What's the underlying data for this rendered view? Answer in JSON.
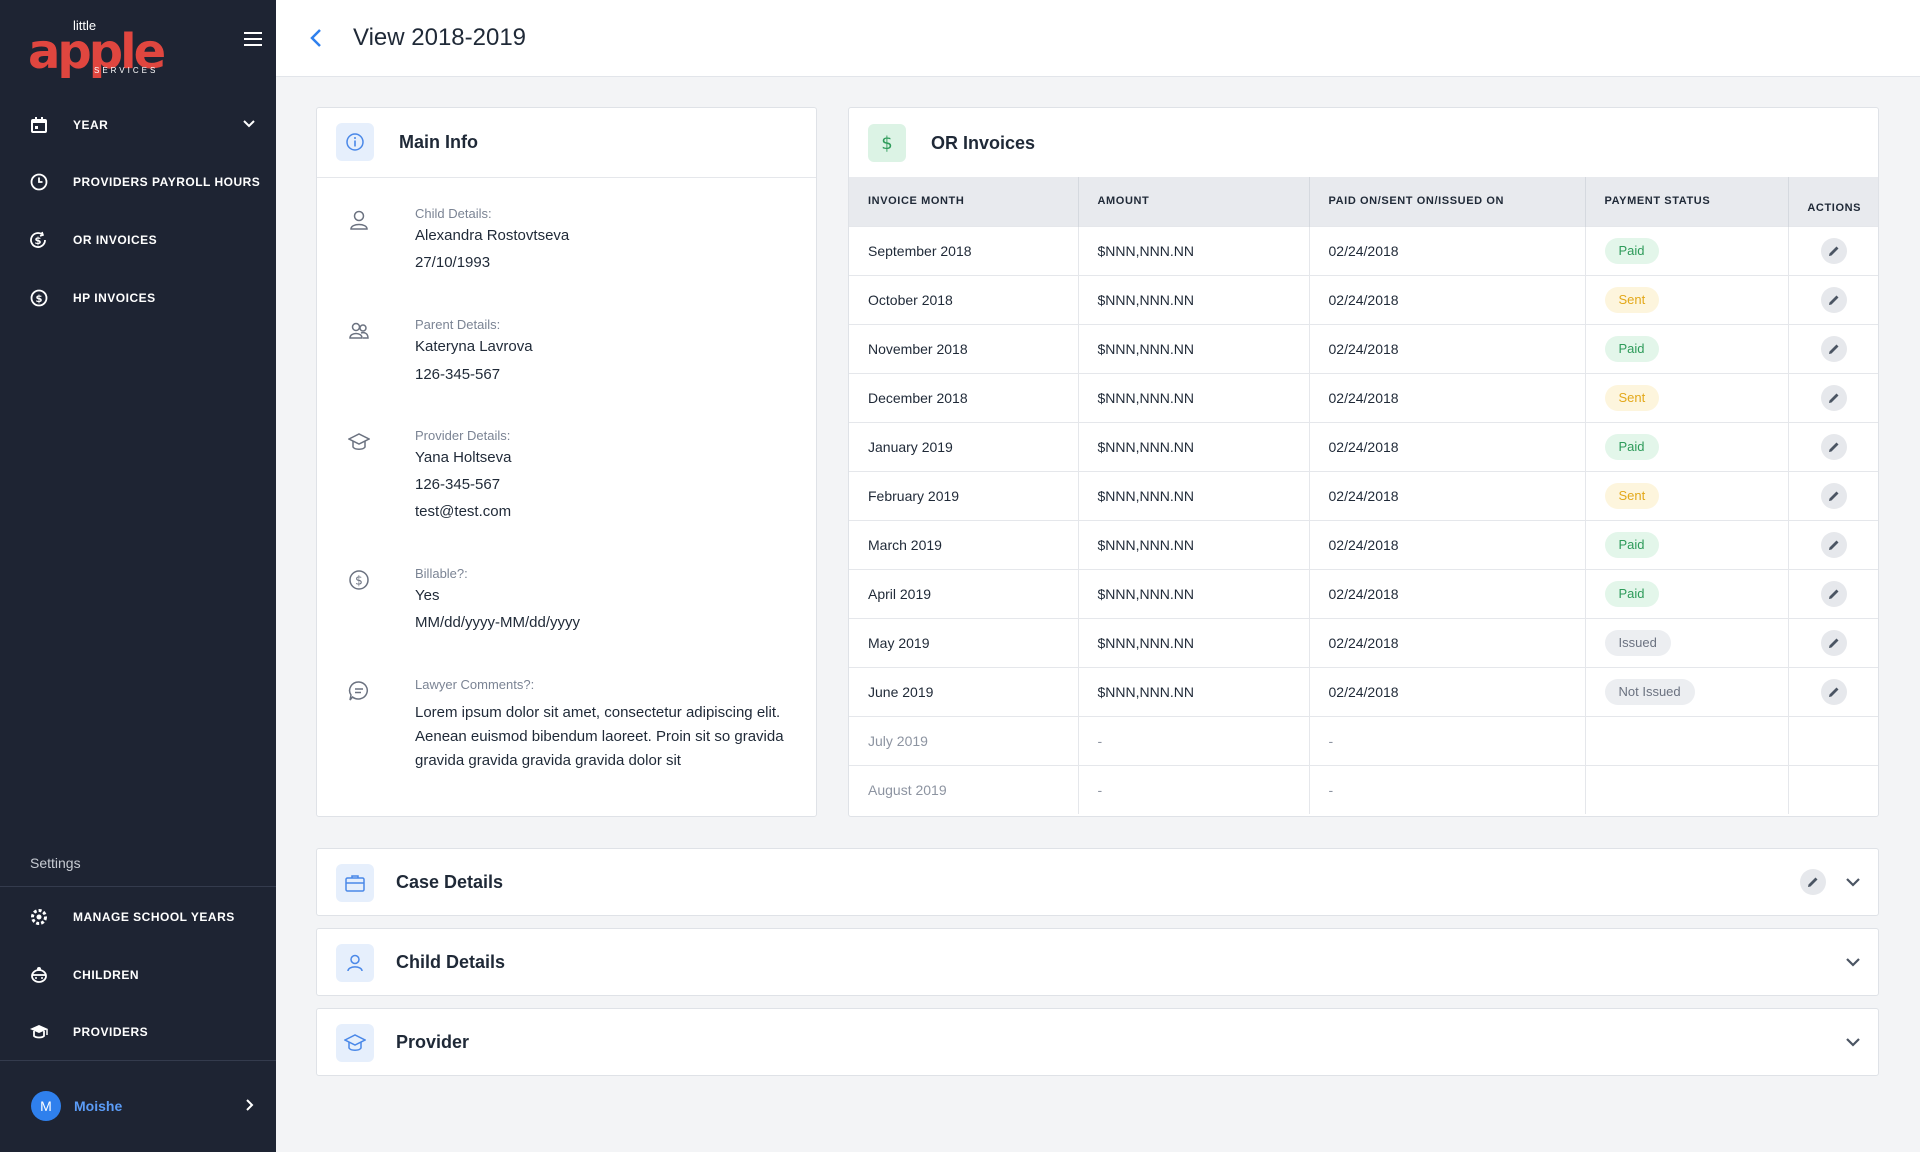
{
  "brand": {
    "small": "little",
    "main": "apple",
    "sub": "SERVICES"
  },
  "sidebar": {
    "items": [
      {
        "label": "YEAR",
        "icon": "calendar-icon"
      },
      {
        "label": "PROVIDERS PAYROLL HOURS",
        "icon": "clock-icon"
      },
      {
        "label": "OR INVOICES",
        "icon": "dollar-refresh-icon"
      },
      {
        "label": "HP INVOICES",
        "icon": "dollar-circle-icon"
      }
    ],
    "settings_label": "Settings",
    "settings_items": [
      {
        "label": "MANAGE SCHOOL YEARS",
        "icon": "gear-icon"
      },
      {
        "label": "CHILDREN",
        "icon": "child-icon"
      },
      {
        "label": "PROVIDERS",
        "icon": "graduation-cap-icon"
      }
    ],
    "user": {
      "initial": "M",
      "name": "Moishe"
    }
  },
  "header": {
    "title": "View 2018-2019"
  },
  "main_info": {
    "title": "Main Info",
    "child": {
      "label": "Child Details:",
      "name": "Alexandra Rostovtseva",
      "dob": "27/10/1993"
    },
    "parent": {
      "label": "Parent Details:",
      "name": "Kateryna Lavrova",
      "phone": "126-345-567"
    },
    "provider": {
      "label": "Provider Details:",
      "name": "Yana Holtseva",
      "phone": "126-345-567",
      "email": "test@test.com"
    },
    "billable": {
      "label": "Billable?:",
      "value": "Yes",
      "range": "MM/dd/yyyy-MM/dd/yyyy"
    },
    "lawyer": {
      "label": "Lawyer Comments?:",
      "comment": "Lorem ipsum dolor sit amet, consectetur adipiscing elit. Aenean euismod bibendum laoreet. Proin sit so gravida gravida gravida gravida  gravida dolor sit"
    }
  },
  "or_invoices": {
    "title": "OR Invoices",
    "columns": [
      "INVOICE MONTH",
      "AMOUNT",
      "PAID ON/SENT ON/ISSUED ON",
      "PAYMENT STATUS",
      "ACTIONS"
    ],
    "rows": [
      {
        "month": "September 2018",
        "amount": "$NNN,NNN.NN",
        "date": "02/24/2018",
        "status": "Paid",
        "kind": "paid"
      },
      {
        "month": "October 2018",
        "amount": "$NNN,NNN.NN",
        "date": "02/24/2018",
        "status": "Sent",
        "kind": "sent"
      },
      {
        "month": "November 2018",
        "amount": "$NNN,NNN.NN",
        "date": "02/24/2018",
        "status": "Paid",
        "kind": "paid"
      },
      {
        "month": "December 2018",
        "amount": "$NNN,NNN.NN",
        "date": "02/24/2018",
        "status": "Sent",
        "kind": "sent"
      },
      {
        "month": "January 2019",
        "amount": "$NNN,NNN.NN",
        "date": "02/24/2018",
        "status": "Paid",
        "kind": "paid"
      },
      {
        "month": "February 2019",
        "amount": "$NNN,NNN.NN",
        "date": "02/24/2018",
        "status": "Sent",
        "kind": "sent"
      },
      {
        "month": "March 2019",
        "amount": "$NNN,NNN.NN",
        "date": "02/24/2018",
        "status": "Paid",
        "kind": "paid"
      },
      {
        "month": "April 2019",
        "amount": "$NNN,NNN.NN",
        "date": "02/24/2018",
        "status": "Paid",
        "kind": "paid"
      },
      {
        "month": "May 2019",
        "amount": "$NNN,NNN.NN",
        "date": "02/24/2018",
        "status": "Issued",
        "kind": "issued"
      },
      {
        "month": "June 2019",
        "amount": "$NNN,NNN.NN",
        "date": "02/24/2018",
        "status": "Not Issued",
        "kind": "issued"
      },
      {
        "month": "July 2019",
        "amount": "-",
        "date": "-",
        "status": "",
        "kind": ""
      },
      {
        "month": "August 2019",
        "amount": "-",
        "date": "-",
        "status": "",
        "kind": ""
      }
    ]
  },
  "sections": {
    "case_details": "Case Details",
    "child_details": "Child Details",
    "provider": "Provider"
  },
  "colors": {
    "sidebar_bg": "#1e2433",
    "accent": "#2f80ed",
    "brand_red": "#e0463f",
    "paid": "#2e9b5a",
    "sent": "#e3a81a"
  }
}
